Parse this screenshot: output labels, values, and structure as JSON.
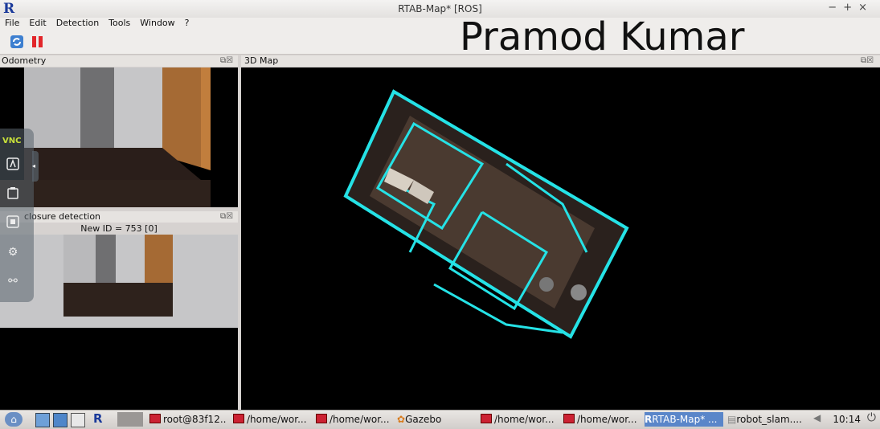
{
  "window": {
    "title": "RTAB-Map* [ROS]",
    "logo": "R",
    "controls": "− + ×"
  },
  "menu": [
    "File",
    "Edit",
    "Detection",
    "Tools",
    "Window",
    "?"
  ],
  "toolbar": {
    "icons": [
      "refresh-icon",
      "pause-icon"
    ]
  },
  "watermark": "Pramod Kumar",
  "docks": {
    "odometry": {
      "title": "Odometry"
    },
    "loop": {
      "title": "Loop closure detection",
      "title_visible": "closure detection",
      "subtitle": "New ID = 753 [0]"
    },
    "map3d": {
      "title": "3D Map"
    }
  },
  "vnc": {
    "label": "VNC",
    "icons": [
      "keyboard-icon",
      "clipboard-icon",
      "screenshot-icon",
      "settings-icon",
      "disconnect-icon"
    ]
  },
  "taskbar": {
    "tasks": [
      "root@83f12...",
      "/home/wor...",
      "/home/wor...",
      "Gazebo",
      "/home/wor...",
      "/home/wor...",
      "RTAB-Map* ...",
      "robot_slam...."
    ],
    "clock": "10:14"
  }
}
